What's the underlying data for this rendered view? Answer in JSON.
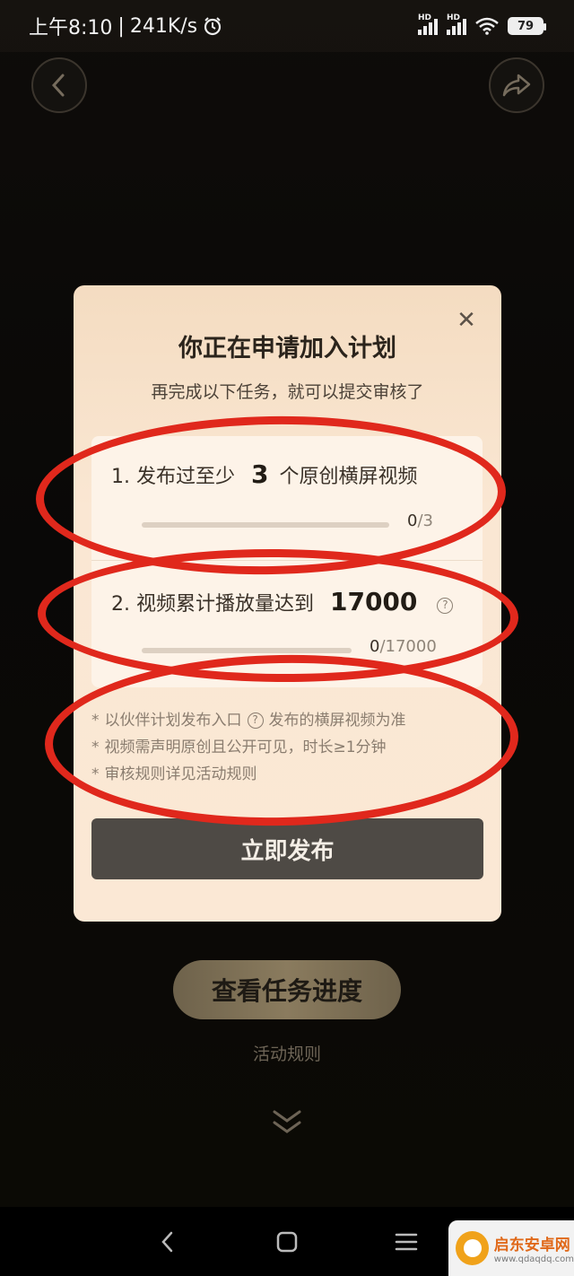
{
  "status_bar": {
    "time": "上午8:10",
    "net_speed": "241K/s",
    "battery": "79",
    "hd_label": "HD"
  },
  "modal": {
    "title": "你正在申请加入计划",
    "subtitle": "再完成以下任务，就可以提交审核了",
    "tasks": [
      {
        "prefix": "1. 发布过至少",
        "number": "3",
        "suffix": "个原创横屏视频",
        "current": "0",
        "target": "/3",
        "progress": 0
      },
      {
        "prefix": "2. 视频累计播放量达到",
        "number": "17000",
        "current": "0",
        "target": "/17000",
        "progress": 0
      }
    ],
    "notes": [
      {
        "bullet": "*",
        "before": "以伙伴计划发布入口",
        "after": "发布的横屏视频为准"
      },
      {
        "bullet": "*",
        "text": "视频需声明原创且公开可见，时长≥1分钟"
      },
      {
        "bullet": "*",
        "text": "审核规则详见活动规则"
      }
    ],
    "publish_label": "立即发布",
    "close_glyph": "✕",
    "help_glyph": "?"
  },
  "page": {
    "progress_button": "查看任务进度",
    "rules_link": "活动规则"
  },
  "watermark": {
    "title": "启东安卓网",
    "url": "www.qdaqdq.com"
  },
  "colors": {
    "annotation": "#e0281c",
    "modal_bg": "#fae7d3",
    "button_dark": "#4e4a45",
    "gold_button": "#8a7b5e"
  }
}
